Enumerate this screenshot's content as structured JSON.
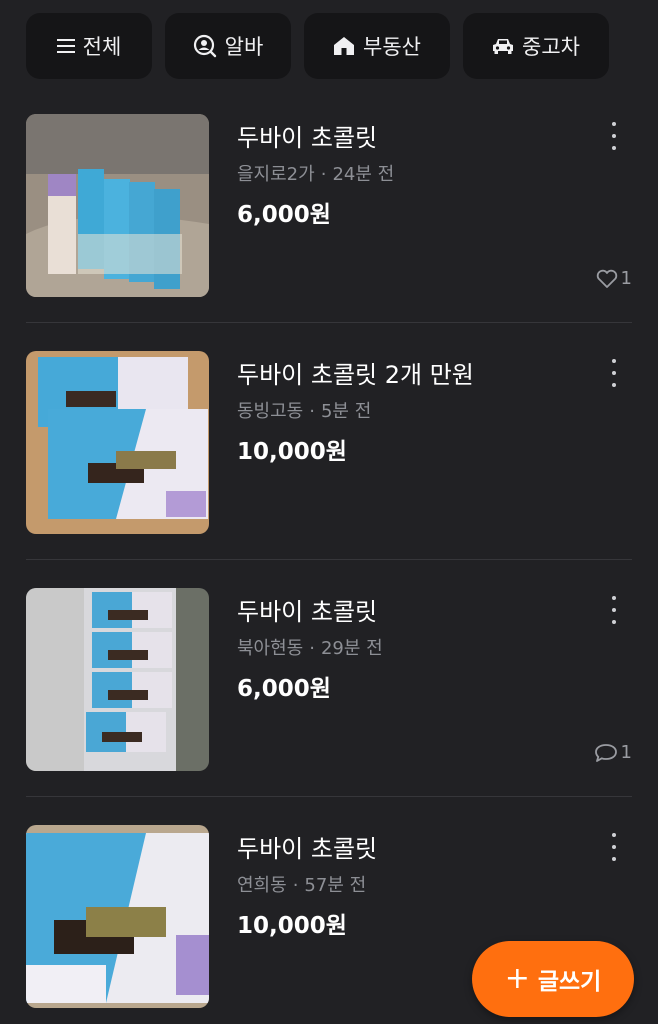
{
  "filters": [
    {
      "label": "전체",
      "icon": "menu-icon"
    },
    {
      "label": "알바",
      "icon": "person-search-icon"
    },
    {
      "label": "부동산",
      "icon": "house-icon"
    },
    {
      "label": "중고차",
      "icon": "car-icon"
    }
  ],
  "items": [
    {
      "title": "두바이 초콜릿",
      "location": "을지로2가",
      "time": "24분 전",
      "price": "6,000원",
      "reaction_icon": "heart-icon",
      "reaction_count": "1"
    },
    {
      "title": "두바이 초콜릿 2개 만원",
      "location": "동빙고동",
      "time": "5분 전",
      "price": "10,000원"
    },
    {
      "title": "두바이 초콜릿",
      "location": "북아현동",
      "time": "29분 전",
      "price": "6,000원",
      "reaction_icon": "chat-icon",
      "reaction_count": "1"
    },
    {
      "title": "두바이 초콜릿",
      "location": "연희동",
      "time": "57분 전",
      "price": "10,000원"
    }
  ],
  "fab": {
    "label": "글쓰기",
    "plus": "+"
  },
  "colors": {
    "background": "#212124",
    "chip": "#151517",
    "accent": "#ff6f0f",
    "meta": "#8d8f95"
  }
}
